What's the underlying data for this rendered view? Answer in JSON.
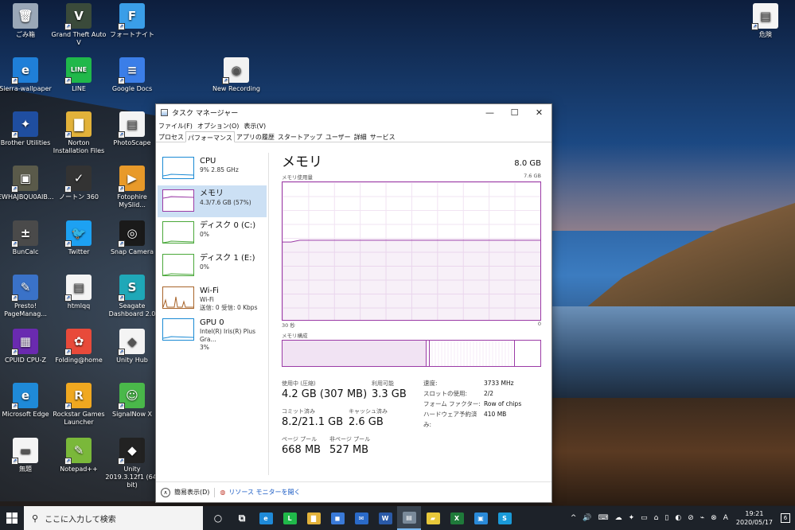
{
  "desktop": {
    "icons": [
      {
        "label": "ごみ箱",
        "glyph": "🗑",
        "color": "#9aa8b8"
      },
      {
        "label": "Grand Theft Auto V",
        "glyph": "V",
        "color": "#3a4a3a"
      },
      {
        "label": "フォートナイト",
        "glyph": "F",
        "color": "#3a9ee8"
      },
      {
        "label": "Sierra-wallpaper",
        "glyph": "e",
        "color": "#1f7fd8"
      },
      {
        "label": "LINE",
        "glyph": "LINE",
        "color": "#20b84a"
      },
      {
        "label": "Google Docs",
        "glyph": "≡",
        "color": "#3b7ee8"
      },
      {
        "label": "New Recording",
        "glyph": "◉",
        "color": "#f2f2f2"
      },
      {
        "label": "Brother Utilities",
        "glyph": "✦",
        "color": "#1f4ea0"
      },
      {
        "label": "Norton Installation Files",
        "glyph": "▇",
        "color": "#e2b23a"
      },
      {
        "label": "PhotoScape",
        "glyph": "▤",
        "color": "#f4f4f4"
      },
      {
        "label": "EWHAJBQU0AIB...",
        "glyph": "▣",
        "color": "#5a5a4a"
      },
      {
        "label": "ノートン 360",
        "glyph": "✓",
        "color": "#333"
      },
      {
        "label": "Fotophire MySlid...",
        "glyph": "▶",
        "color": "#e89a2a"
      },
      {
        "label": "BunCalc",
        "glyph": "±",
        "color": "#4a4a4a"
      },
      {
        "label": "Twitter",
        "glyph": "🐦",
        "color": "#1da1f2"
      },
      {
        "label": "Snap Camera",
        "glyph": "◎",
        "color": "#1a1a1a"
      },
      {
        "label": "Presto! PageManag...",
        "glyph": "✎",
        "color": "#3a72c8"
      },
      {
        "label": "htmlqq",
        "glyph": "▤",
        "color": "#f4f4f4"
      },
      {
        "label": "Seagate Dashboard 2.0",
        "glyph": "S",
        "color": "#1fa8b8"
      },
      {
        "label": "CPUID CPU-Z",
        "glyph": "▦",
        "color": "#6a2ab0"
      },
      {
        "label": "Folding@home",
        "glyph": "✿",
        "color": "#e84a3a"
      },
      {
        "label": "Unity Hub",
        "glyph": "◆",
        "color": "#f4f4f4"
      },
      {
        "label": "Microsoft Edge",
        "glyph": "e",
        "color": "#1f8ad8"
      },
      {
        "label": "Rockstar Games Launcher",
        "glyph": "R",
        "color": "#f0a820"
      },
      {
        "label": "SignalNow X",
        "glyph": "☺",
        "color": "#4ab84a"
      },
      {
        "label": "無題",
        "glyph": "▬",
        "color": "#f4f4f4"
      },
      {
        "label": "Notepad++",
        "glyph": "✎",
        "color": "#7ab83a"
      },
      {
        "label": "Unity 2019.3.12f1 (64-bit)",
        "glyph": "◆",
        "color": "#222"
      },
      {
        "label": "危険",
        "glyph": "▤",
        "color": "#f4f4f4"
      }
    ]
  },
  "window": {
    "title": "タスク マネージャー",
    "controls": {
      "minimize": "—",
      "maximize": "☐",
      "close": "✕"
    },
    "menu": [
      "ファイル(F)",
      "オプション(O)",
      "表示(V)"
    ],
    "tabs": [
      "プロセス",
      "パフォーマンス",
      "アプリの履歴",
      "スタートアップ",
      "ユーザー",
      "詳細",
      "サービス"
    ],
    "active_tab": "パフォーマンス",
    "sidebar": [
      {
        "name": "CPU",
        "sub1": "9%  2.85 GHz",
        "sub2": "",
        "color": "#1a8ad4"
      },
      {
        "name": "メモリ",
        "sub1": "4.3/7.6 GB (57%)",
        "sub2": "",
        "color": "#9b3ba6"
      },
      {
        "name": "ディスク 0 (C:)",
        "sub1": "0%",
        "sub2": "",
        "color": "#4aa83a"
      },
      {
        "name": "ディスク 1 (E:)",
        "sub1": "0%",
        "sub2": "",
        "color": "#4aa83a"
      },
      {
        "name": "Wi-Fi",
        "sub1": "Wi-Fi",
        "sub2": "送信: 0  受信: 0 Kbps",
        "color": "#a8642a"
      },
      {
        "name": "GPU 0",
        "sub1": "Intel(R) Iris(R) Plus Gra...",
        "sub2": "3%",
        "color": "#1a8ad4"
      }
    ],
    "main": {
      "title": "メモリ",
      "total": "8.0 GB",
      "graph_label": "メモリ使用量",
      "graph_max": "7.6 GB",
      "axis_left": "30 秒",
      "axis_right": "0",
      "composition_label": "メモリ構成",
      "stats": {
        "in_use_label": "使用中 (圧縮)",
        "in_use": "4.2 GB (307 MB)",
        "available_label": "利用可能",
        "available": "3.3 GB",
        "committed_label": "コミット済み",
        "committed": "8.2/21.1 GB",
        "cached_label": "キャッシュ済み",
        "cached": "2.6 GB",
        "paged_label": "ページ プール",
        "paged": "668 MB",
        "nonpaged_label": "非ページ プール",
        "nonpaged": "527 MB"
      },
      "details": [
        {
          "k": "速度:",
          "v": "3733 MHz"
        },
        {
          "k": "スロットの使用:",
          "v": "2/2"
        },
        {
          "k": "フォーム ファクター:",
          "v": "Row of chips"
        },
        {
          "k": "ハードウェア予約済み:",
          "v": "410 MB"
        }
      ]
    },
    "footer": {
      "less": "簡易表示(D)",
      "resmon": "リソース モニターを開く"
    }
  },
  "chart_data": {
    "type": "area",
    "title": "メモリ使用量",
    "ylim": [
      0,
      7.6
    ],
    "x": [
      30,
      29,
      28,
      27,
      25,
      20,
      15,
      10,
      5,
      0
    ],
    "values": [
      4.3,
      4.3,
      4.4,
      4.4,
      4.4,
      4.4,
      4.4,
      4.4,
      4.4,
      4.4
    ],
    "xlabel": "",
    "ylabel": ""
  },
  "taskbar": {
    "search_placeholder": "ここに入力して検索",
    "time": "19:21",
    "date": "2020/05/17",
    "notification_count": "6",
    "apps": [
      {
        "name": "cortana",
        "glyph": "○",
        "color": "transparent"
      },
      {
        "name": "task-view",
        "glyph": "⧉",
        "color": "transparent"
      },
      {
        "name": "edge",
        "glyph": "e",
        "color": "#1f8ad8"
      },
      {
        "name": "line",
        "glyph": "L",
        "color": "#20b84a"
      },
      {
        "name": "explorer",
        "glyph": "▇",
        "color": "#e2b23a"
      },
      {
        "name": "store",
        "glyph": "◼",
        "color": "#3a7ad8"
      },
      {
        "name": "mail",
        "glyph": "✉",
        "color": "#2a6ac8"
      },
      {
        "name": "word",
        "glyph": "W",
        "color": "#2a5aa8"
      },
      {
        "name": "task-manager",
        "glyph": "▤",
        "color": "#7a8a9a"
      },
      {
        "name": "sticky",
        "glyph": "▰",
        "color": "#e8c83a"
      },
      {
        "name": "excel",
        "glyph": "X",
        "color": "#1f7a3a"
      },
      {
        "name": "photos",
        "glyph": "▣",
        "color": "#2a8ad8"
      },
      {
        "name": "skype",
        "glyph": "S",
        "color": "#1a9ad8"
      }
    ],
    "tray": [
      "^",
      "🔊",
      "⌨",
      "☁",
      "✦",
      "▭",
      "⌂",
      "▯",
      "◐",
      "⊘",
      "⌁",
      "⊗",
      "A"
    ]
  }
}
